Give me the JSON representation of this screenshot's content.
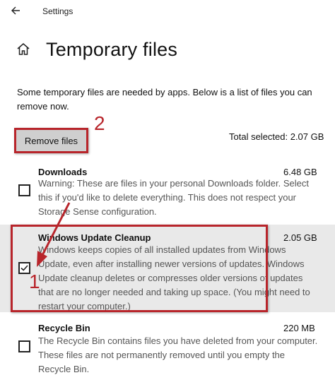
{
  "window": {
    "title": "Settings"
  },
  "page": {
    "title": "Temporary files",
    "intro": "Some temporary files are needed by apps. Below is a list of files you can remove now."
  },
  "toolbar": {
    "remove_label": "Remove files",
    "total_selected": "Total selected: 2.07 GB"
  },
  "items": [
    {
      "title": "Downloads",
      "size": "6.48 GB",
      "description": "Warning: These are files in your personal Downloads folder. Select this if you'd like to delete everything. This does not respect your Storage Sense configuration.",
      "checked": false
    },
    {
      "title": "Windows Update Cleanup",
      "size": "2.05 GB",
      "description": "Windows keeps copies of all installed updates from Windows Update, even after installing newer versions of updates. Windows Update cleanup deletes or compresses older versions of updates that are no longer needed and taking up space. (You might need to restart your computer.)",
      "checked": true
    },
    {
      "title": "Recycle Bin",
      "size": "220 MB",
      "description": "The Recycle Bin contains files you have deleted from your computer. These files are not permanently removed until you empty the Recycle Bin.",
      "checked": false
    }
  ],
  "annotations": {
    "step1": "1",
    "step2": "2",
    "color": "#b8252b"
  },
  "icons": {
    "back": "back-arrow-icon",
    "home": "home-icon",
    "check": "checkmark-icon"
  }
}
